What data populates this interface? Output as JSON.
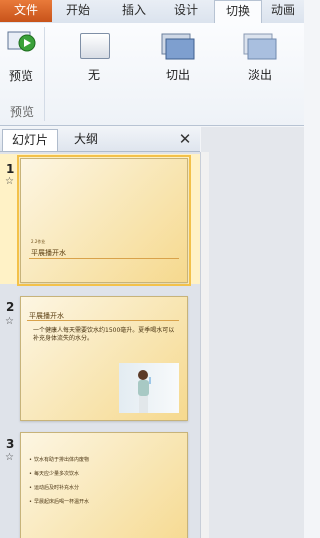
{
  "ribbon_tabs": [
    "文件",
    "开始",
    "插入",
    "设计",
    "切换",
    "动画"
  ],
  "ribbon": {
    "preview_label": "预览",
    "preview_group": "预览",
    "transitions": [
      "无",
      "切出",
      "淡出"
    ]
  },
  "pane": {
    "tabs": [
      "幻灯片",
      "大纲"
    ],
    "close_label": "✕"
  },
  "slides": [
    {
      "num": "1",
      "star": "☆",
      "small": "2.2作业",
      "title": "平展播开水"
    },
    {
      "num": "2",
      "star": "☆",
      "title": "平展播开水",
      "bullet": "一个健康人每天需要饮水约1500毫升。夏季喝水可以补充身体流失的水分。"
    },
    {
      "num": "3",
      "star": "☆",
      "bullets": [
        "饮水有助于排出体内废物",
        "每天应少量多次饮水",
        "运动后及时补充水分",
        "早晨起床后喝一杯温开水"
      ]
    }
  ],
  "colors": {
    "file_tab": "#d8642a",
    "accent": "#f3c14a"
  }
}
